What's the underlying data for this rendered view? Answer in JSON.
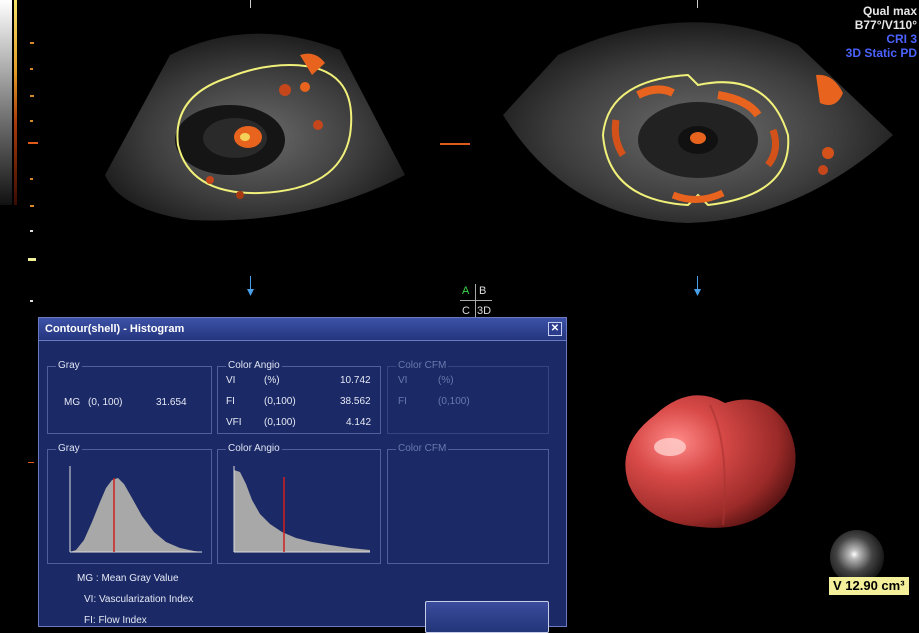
{
  "overlay": {
    "quality": "Qual max",
    "angles": "B77°/V110°",
    "cri": "CRI 3",
    "mode": "3D Static PD"
  },
  "quad": {
    "a": "A",
    "b": "B",
    "c": "C",
    "d": "3D"
  },
  "dialog": {
    "title": "Contour(shell) - Histogram",
    "gray_group": "Gray",
    "mg_label": "MG",
    "mg_range": "(0, 100)",
    "mg_value": "31.654",
    "angio_group": "Color Angio",
    "vi_label": "VI",
    "vi_range": "(%)",
    "vi_value": "10.742",
    "fi_label": "FI",
    "fi_range": "(0,100)",
    "fi_value": "38.562",
    "vfi_label": "VFI",
    "vfi_range": "(0,100)",
    "vfi_value": "4.142",
    "cfm_group": "Color CFM",
    "cfm_vi_label": "VI",
    "cfm_vi_range": "(%)",
    "cfm_fi_label": "FI",
    "cfm_fi_range": "(0,100)",
    "hist_gray_label": "Gray",
    "hist_angio_label": "Color Angio",
    "hist_cfm_label": "Color CFM",
    "legend_mg": "MG :   Mean Gray Value",
    "legend_vi": "VI:    Vascularization Index",
    "legend_fi": "FI:    Flow Index"
  },
  "volume": "V 12.90 cm³",
  "colors": {
    "dialog_bg": "#1b2a66",
    "contour": "#f0f07a",
    "flow": "#e8641e",
    "marker": "#e05a1a",
    "histogram_fill": "#a8a8a8",
    "histogram_line": "#d02020",
    "volume_badge": "#f3ef9a",
    "object": "#d84a48"
  }
}
